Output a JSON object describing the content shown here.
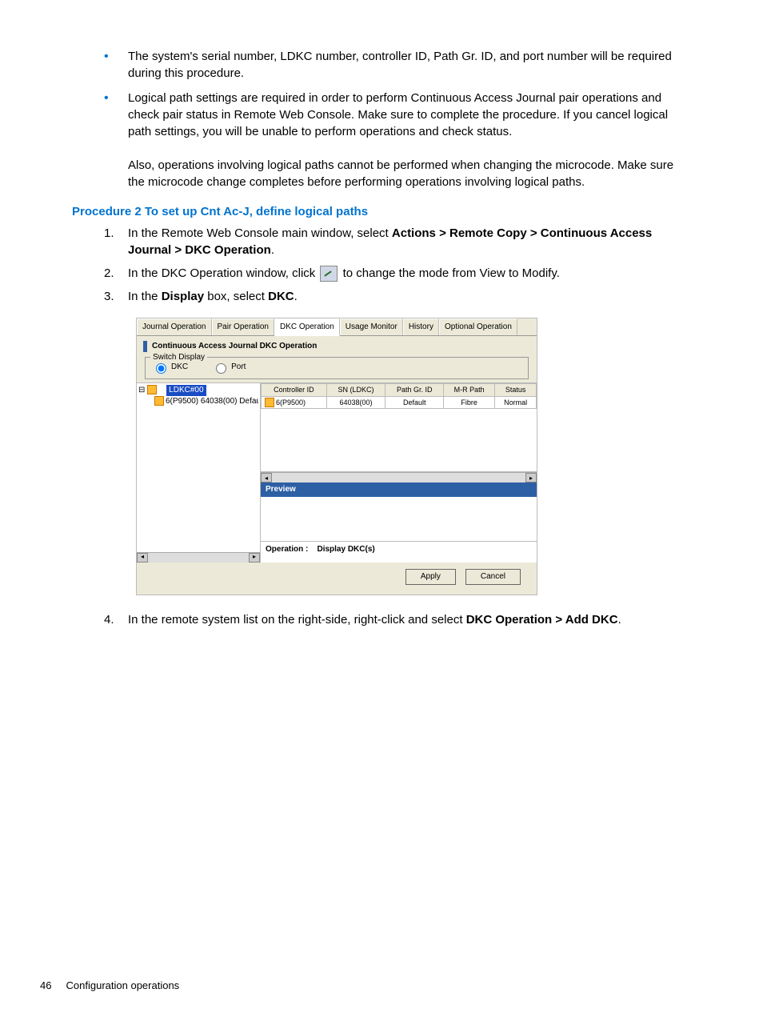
{
  "bullets": [
    "The system's serial number, LDKC number, controller ID, Path Gr. ID, and port number will be required during this procedure.",
    "Logical path settings are required in order to perform Continuous Access Journal pair operations and check pair status in Remote Web Console. Make sure to complete the procedure. If you cancel logical path settings, you will be unable to perform operations and check status.",
    "Also, operations involving logical paths cannot be performed when changing the microcode. Make sure the microcode change completes before performing operations involving logical paths."
  ],
  "procedure_title": "Procedure 2 To set up Cnt Ac-J, define logical paths",
  "steps": {
    "s1_a": "In the Remote Web Console main window, select ",
    "s1_b": "Actions > Remote Copy > Continuous Access Journal > DKC Operation",
    "s1_c": ".",
    "s2_a": "In the DKC Operation window, click ",
    "s2_b": " to change the mode from View to Modify.",
    "s3_a": "In the ",
    "s3_b": "Display",
    "s3_c": " box, select ",
    "s3_d": "DKC",
    "s3_e": ".",
    "s4_a": "In the remote system list on the right-side, right-click and select ",
    "s4_b": "DKC Operation > Add DKC",
    "s4_c": "."
  },
  "shot": {
    "tabs": [
      "Journal Operation",
      "Pair Operation",
      "DKC Operation",
      "Usage Monitor",
      "History",
      "Optional Operation"
    ],
    "panel_title": "Continuous Access Journal DKC Operation",
    "switch_label": "Switch Display",
    "radio_dkc": "DKC",
    "radio_port": "Port",
    "tree_root": "LDKC#00",
    "tree_child": "6(P9500) 64038(00) Defau",
    "headers": [
      "Controller ID",
      "SN (LDKC)",
      "Path Gr. ID",
      "M-R Path",
      "Status"
    ],
    "row": [
      "6(P9500)",
      "64038(00)",
      "Default",
      "Fibre",
      "Normal"
    ],
    "preview": "Preview",
    "operation_label": "Operation :",
    "operation_value": "Display DKC(s)",
    "apply": "Apply",
    "cancel": "Cancel"
  },
  "footer_page": "46",
  "footer_text": "Configuration operations"
}
